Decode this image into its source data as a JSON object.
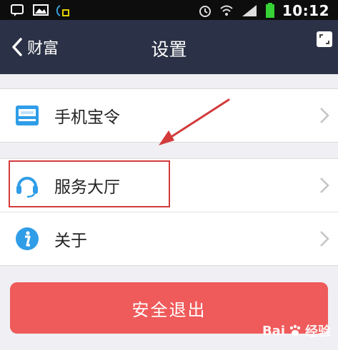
{
  "status_bar": {
    "time": "10:12"
  },
  "nav": {
    "back_label": "财富",
    "title": "设置"
  },
  "menu": {
    "items": [
      {
        "label": "手机宝令",
        "icon": "token-device-icon"
      },
      {
        "label": "服务大厅",
        "icon": "headset-icon"
      },
      {
        "label": "关于",
        "icon": "info-icon"
      }
    ]
  },
  "logout": {
    "label": "安全退出"
  },
  "watermark": {
    "brand": "Bai",
    "suffix": "经验"
  },
  "colors": {
    "nav_bg": "#2b3146",
    "logout_bg": "#ef5a5a",
    "annotation_red": "#d33b3b",
    "icon_blue": "#2f9de8"
  }
}
